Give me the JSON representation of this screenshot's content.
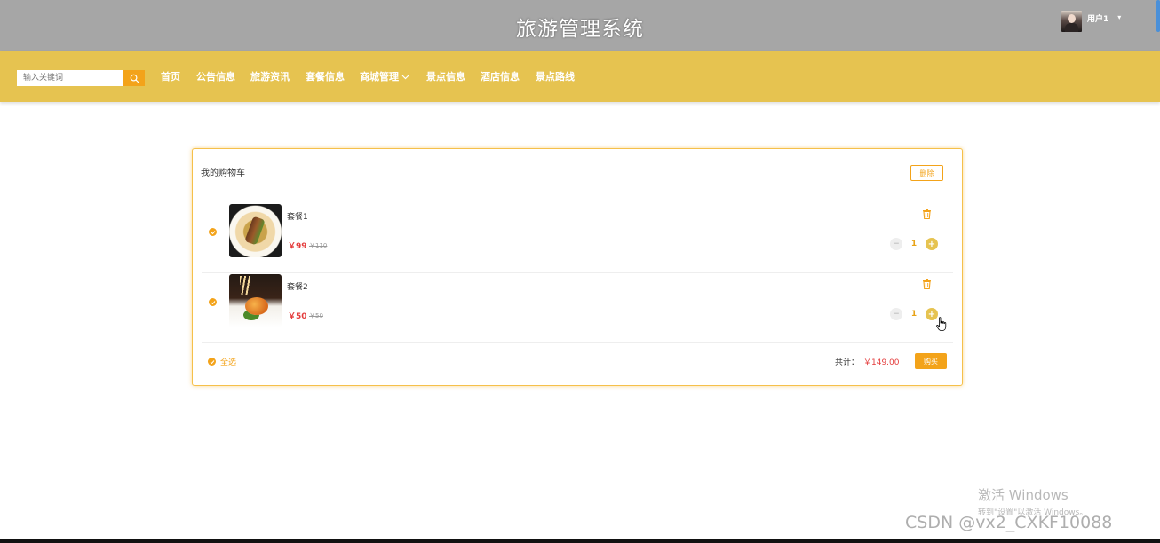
{
  "header": {
    "site_title": "旅游管理系统",
    "user_name": "用户1",
    "user_caret": "▾"
  },
  "nav": {
    "search_placeholder": "输入关键词",
    "items": [
      "首页",
      "公告信息",
      "旅游资讯",
      "套餐信息",
      "商城管理",
      "景点信息",
      "酒店信息",
      "景点路线"
    ]
  },
  "cart": {
    "title": "我的购物车",
    "delete_label": "删除",
    "items": [
      {
        "name": "套餐1",
        "price": "￥99",
        "old_price": "￥110",
        "quantity": "1"
      },
      {
        "name": "套餐2",
        "price": "￥50",
        "old_price": "￥50",
        "quantity": "1"
      }
    ],
    "select_all_label": "全选",
    "total_label": "共计：",
    "total_value": "￥149.00",
    "buy_label": "购买"
  },
  "overlay": {
    "windows_title": "激活 Windows",
    "windows_sub": "转到\"设置\"以激活 Windows。",
    "watermark": "CSDN @vx2_CXKF10088"
  },
  "colors": {
    "header_bg": "#a6a6a6",
    "nav_bg": "#e6c350",
    "accent": "#f3a31a",
    "price": "#e43c3c"
  },
  "icons": {
    "search": "search-icon",
    "trash": "trash-icon",
    "check": "check-circle-icon",
    "chevron": "chevron-down-icon",
    "cursor": "hand-cursor-icon"
  }
}
